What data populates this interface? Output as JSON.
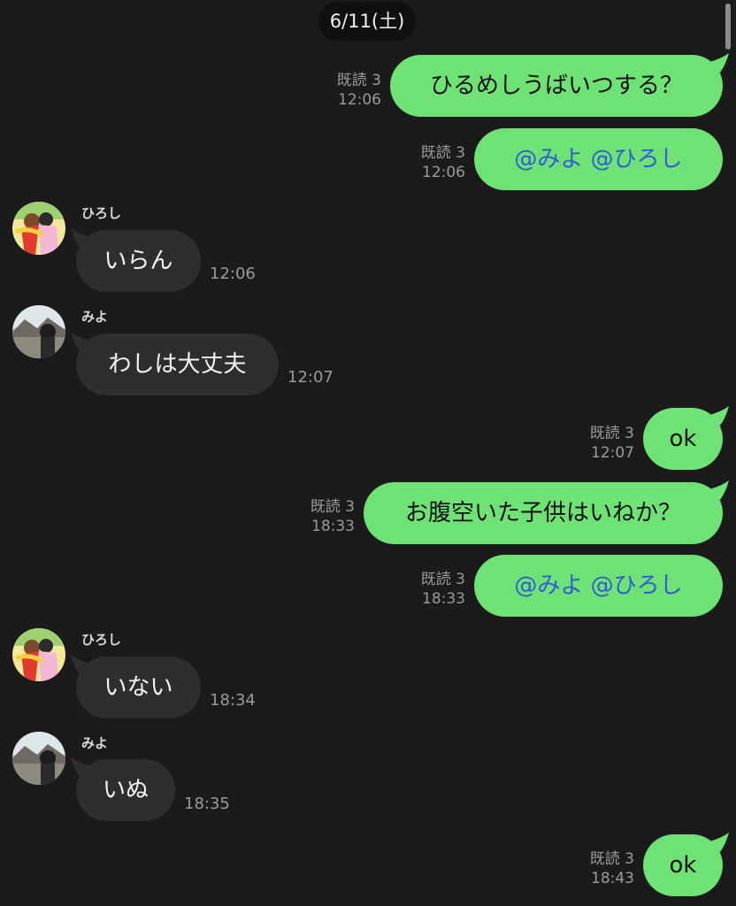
{
  "header": {
    "date": "6/11(土)"
  },
  "colors": {
    "background": "#1b1b1b",
    "outgoing_bubble": "#6fe276",
    "incoming_bubble": "#2e2e2e",
    "mention_text": "#2d5ed6"
  },
  "messages": [
    {
      "side": "out",
      "text": "ひるめしうばいつする？",
      "read": "既読 3",
      "time": "12:06"
    },
    {
      "side": "out",
      "text": "@みよ @ひろし",
      "read": "既読 3",
      "time": "12:06",
      "mention": true
    },
    {
      "side": "in",
      "sender": "ひろし",
      "text": "いらん",
      "time": "12:06",
      "avatar": "hiroshi-avatar-icon"
    },
    {
      "side": "in",
      "sender": "みよ",
      "text": "わしは大丈夫",
      "time": "12:07",
      "avatar": "miyo-avatar-icon"
    },
    {
      "side": "out",
      "text": "ok",
      "read": "既読 3",
      "time": "12:07"
    },
    {
      "side": "out",
      "text": "お腹空いた子供はいねか？",
      "read": "既読 3",
      "time": "18:33"
    },
    {
      "side": "out",
      "text": "@みよ @ひろし",
      "read": "既読 3",
      "time": "18:33",
      "mention": true
    },
    {
      "side": "in",
      "sender": "ひろし",
      "text": "いない",
      "time": "18:34",
      "avatar": "hiroshi-avatar-icon"
    },
    {
      "side": "in",
      "sender": "みよ",
      "text": "いぬ",
      "time": "18:35",
      "avatar": "miyo-avatar-icon"
    },
    {
      "side": "out",
      "text": "ok",
      "read": "既読 3",
      "time": "18:43"
    }
  ]
}
